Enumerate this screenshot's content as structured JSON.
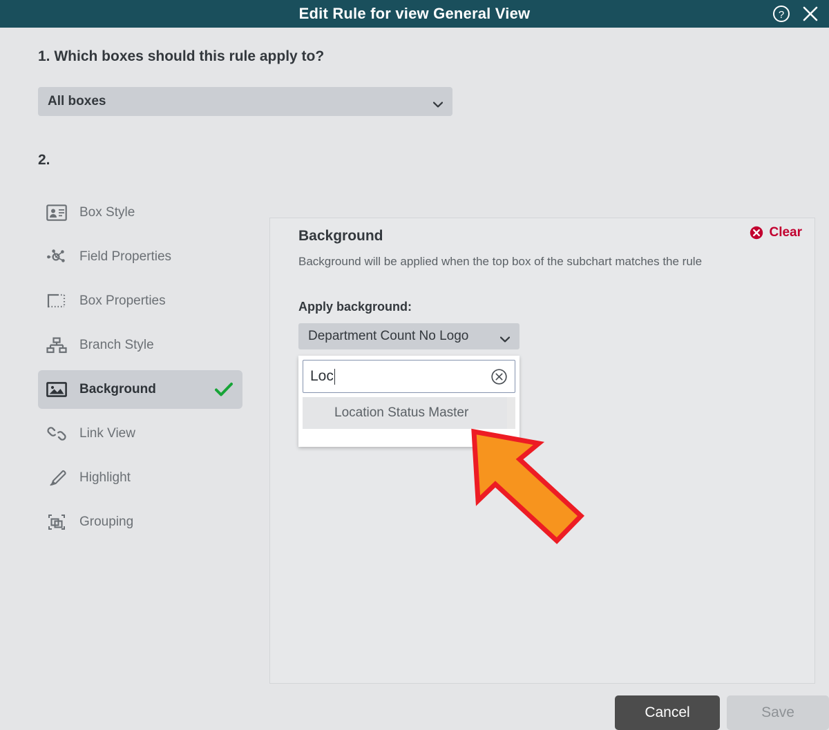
{
  "titlebar": {
    "title": "Edit Rule for view General View",
    "help_icon": "help-circle-icon",
    "close_icon": "close-icon",
    "background_color": "#1a4f5c"
  },
  "step1": {
    "heading": "1. Which boxes should this rule apply to?",
    "select_value": "All boxes",
    "chevron_icon": "chevron-down-icon"
  },
  "step2": {
    "heading": "2."
  },
  "sidebar": {
    "items": [
      {
        "label": "Box Style",
        "icon": "id-card-icon",
        "active": false
      },
      {
        "label": "Field Properties",
        "icon": "node-network-icon",
        "active": false
      },
      {
        "label": "Box Properties",
        "icon": "dashed-box-icon",
        "active": false
      },
      {
        "label": "Branch Style",
        "icon": "org-chart-icon",
        "active": false
      },
      {
        "label": "Background",
        "icon": "image-icon",
        "active": true,
        "check_icon": "green-check-icon"
      },
      {
        "label": "Link View",
        "icon": "link-chain-icon",
        "active": false
      },
      {
        "label": "Highlight",
        "icon": "highlighter-pen-icon",
        "active": false
      },
      {
        "label": "Grouping",
        "icon": "grouping-shapes-icon",
        "active": false
      }
    ]
  },
  "panel": {
    "title": "Background",
    "description": "Background will be applied when the top box of the subchart matches the rule",
    "clear": {
      "label": "Clear",
      "icon": "clear-circle-x-icon",
      "color": "#c2002f"
    },
    "apply_label": "Apply background:",
    "background_select": {
      "value": "Department Count No Logo",
      "chevron_icon": "chevron-down-icon"
    },
    "dropdown": {
      "search_value": "Loc",
      "clear_icon": "circle-x-icon",
      "options": [
        "Location Status Master"
      ],
      "scrollbar": "vertical-scrollbar"
    }
  },
  "annotation": {
    "arrow": "pointer-arrow-annotation",
    "fill_color": "#f7941e",
    "stroke_color": "#ed1c24"
  },
  "footer": {
    "cancel_label": "Cancel",
    "save_label": "Save",
    "save_disabled": true
  }
}
